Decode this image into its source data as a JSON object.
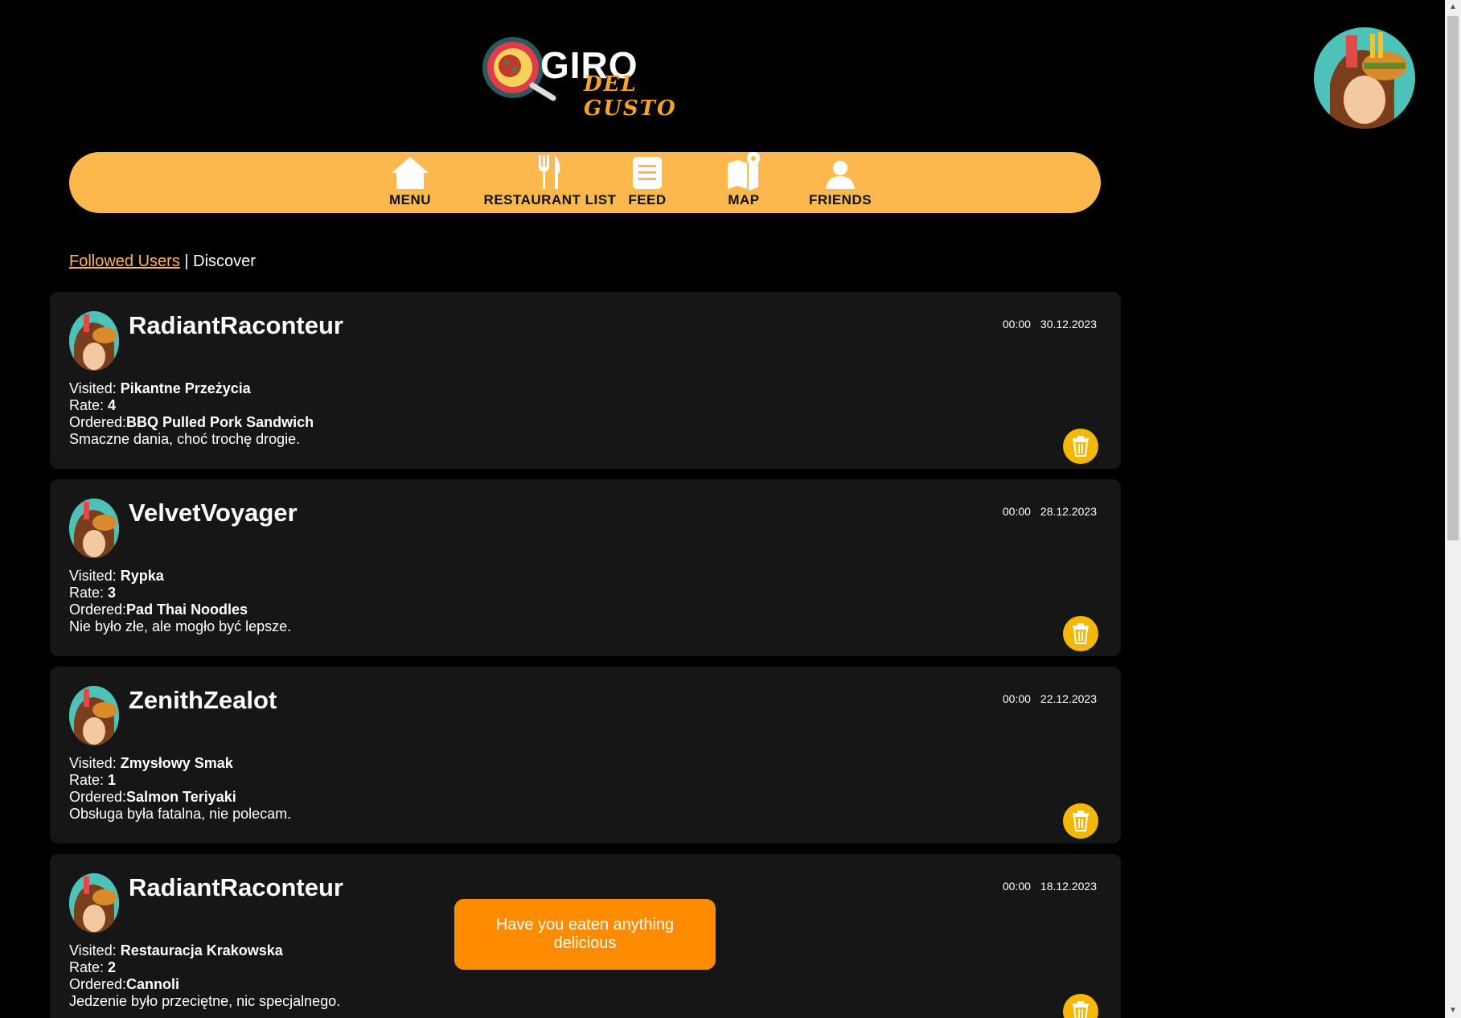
{
  "logo": {
    "word1": "GIRO",
    "word2": "DEL GUSTO"
  },
  "nav": {
    "items": [
      {
        "label": "MENU",
        "icon": "home-icon"
      },
      {
        "label": "RESTAURANT LIST",
        "icon": "fork-knife-icon"
      },
      {
        "label": "FEED",
        "icon": "document-icon"
      },
      {
        "label": "MAP",
        "icon": "map-pin-icon"
      },
      {
        "label": "FRIENDS",
        "icon": "person-icon"
      }
    ]
  },
  "tabs": {
    "followed": "Followed Users",
    "separator": "|",
    "discover": "Discover"
  },
  "labels": {
    "visited": "Visited: ",
    "rate": "Rate: ",
    "ordered": "Ordered:"
  },
  "posts": [
    {
      "user": "RadiantRaconteur",
      "time": "00:00",
      "date": "30.12.2023",
      "visited": "Pikantne Przeżycia",
      "rate": "4",
      "ordered": "BBQ Pulled Pork Sandwich",
      "comment": "Smaczne dania, choć trochę drogie."
    },
    {
      "user": "VelvetVoyager",
      "time": "00:00",
      "date": "28.12.2023",
      "visited": "Rypka",
      "rate": "3",
      "ordered": "Pad Thai Noodles",
      "comment": "Nie było złe, ale mogło być lepsze."
    },
    {
      "user": "ZenithZealot",
      "time": "00:00",
      "date": "22.12.2023",
      "visited": "Zmysłowy Smak",
      "rate": "1",
      "ordered": "Salmon Teriyaki",
      "comment": "Obsługa była fatalna, nie polecam."
    },
    {
      "user": "RadiantRaconteur",
      "time": "00:00",
      "date": "18.12.2023",
      "visited": "Restauracja Krakowska",
      "rate": "2",
      "ordered": "Cannoli",
      "comment": "Jedzenie było przeciętne, nic specjalnego."
    }
  ],
  "prompt": {
    "text": "Have you eaten anything delicious"
  },
  "colors": {
    "accent": "#fdb84d",
    "prompt": "#ff8c00",
    "card": "#161616",
    "trash": "#f5b700"
  }
}
